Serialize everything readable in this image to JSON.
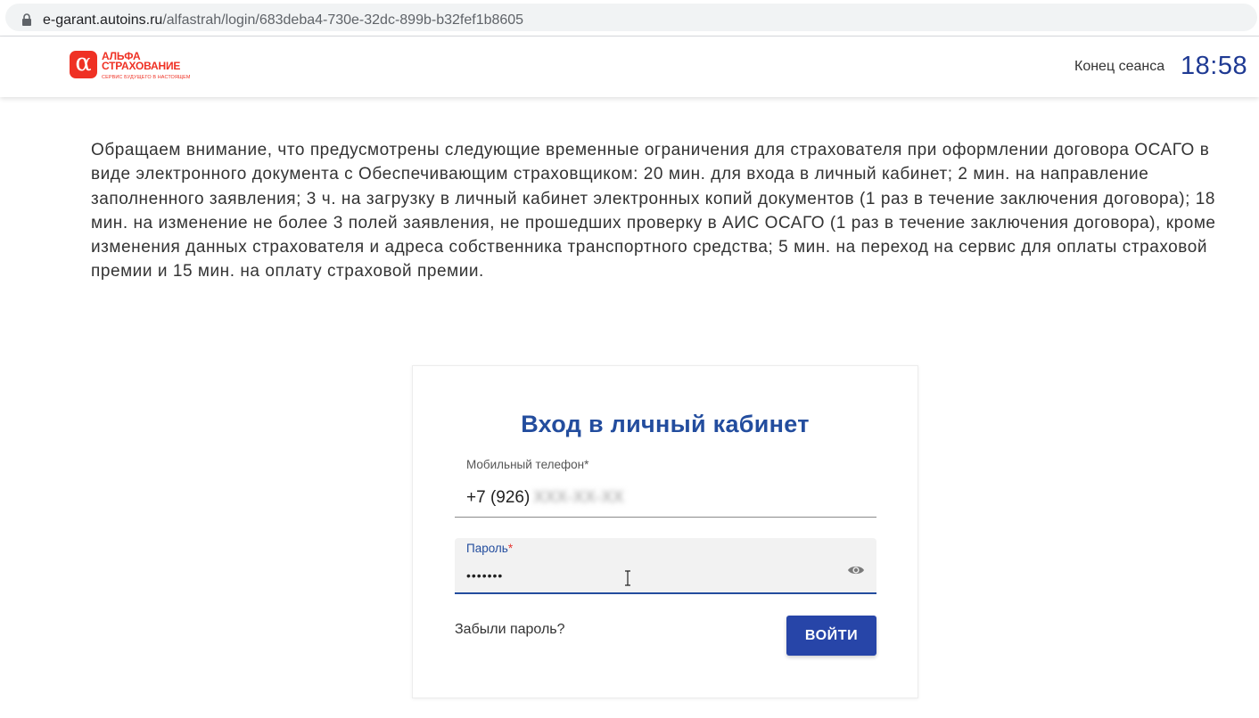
{
  "browser": {
    "url_host": "e-garant.autoins.ru",
    "url_path": "/alfastrah/login/683deba4-730e-32dc-899b-b32fef1b8605",
    "lock_icon": "lock-icon"
  },
  "header": {
    "logo": {
      "mark": "α",
      "name_line1": "АЛЬФА",
      "name_line2": "СТРАХОВАНИЕ",
      "slogan": "СЕРВИС БУДУЩЕГО В НАСТОЯЩЕМ",
      "brand_color": "#ef3124"
    },
    "session_label": "Конец сеанса",
    "session_timer": "18:58"
  },
  "notice": "Обращаем внимание, что предусмотрены следующие временные ограничения для страхователя при оформлении договора ОСАГО в виде электронного документа с Обеспечивающим страховщиком: 20 мин. для входа в личный кабинет; 2 мин. на направление заполненного заявления; 3 ч. на загрузку в личный кабинет электронных копий документов (1 раз в течение заключения договора); 18 мин. на изменение не более 3 полей заявления, не прошедших проверку в АИС ОСАГО (1 раз в течение заключения договора), кроме изменения данных страхователя и адреса собственника транспортного средства; 5 мин. на переход на сервис для оплаты страховой премии и 15 мин. на оплату страховой премии.",
  "login": {
    "title": "Вход в личный кабинет",
    "phone": {
      "label": "Мобильный телефон",
      "required_mark": "*",
      "value_visible": "+7 (926)",
      "value_hidden": "XXX-XX-XX"
    },
    "password": {
      "label": "Пароль",
      "required_mark": "*",
      "value": "•••••••",
      "toggle_icon": "eye-icon"
    },
    "forgot_label": "Забыли пароль?",
    "submit_label": "ВОЙТИ",
    "accent_color": "#234d9e",
    "button_color": "#2745a8"
  }
}
